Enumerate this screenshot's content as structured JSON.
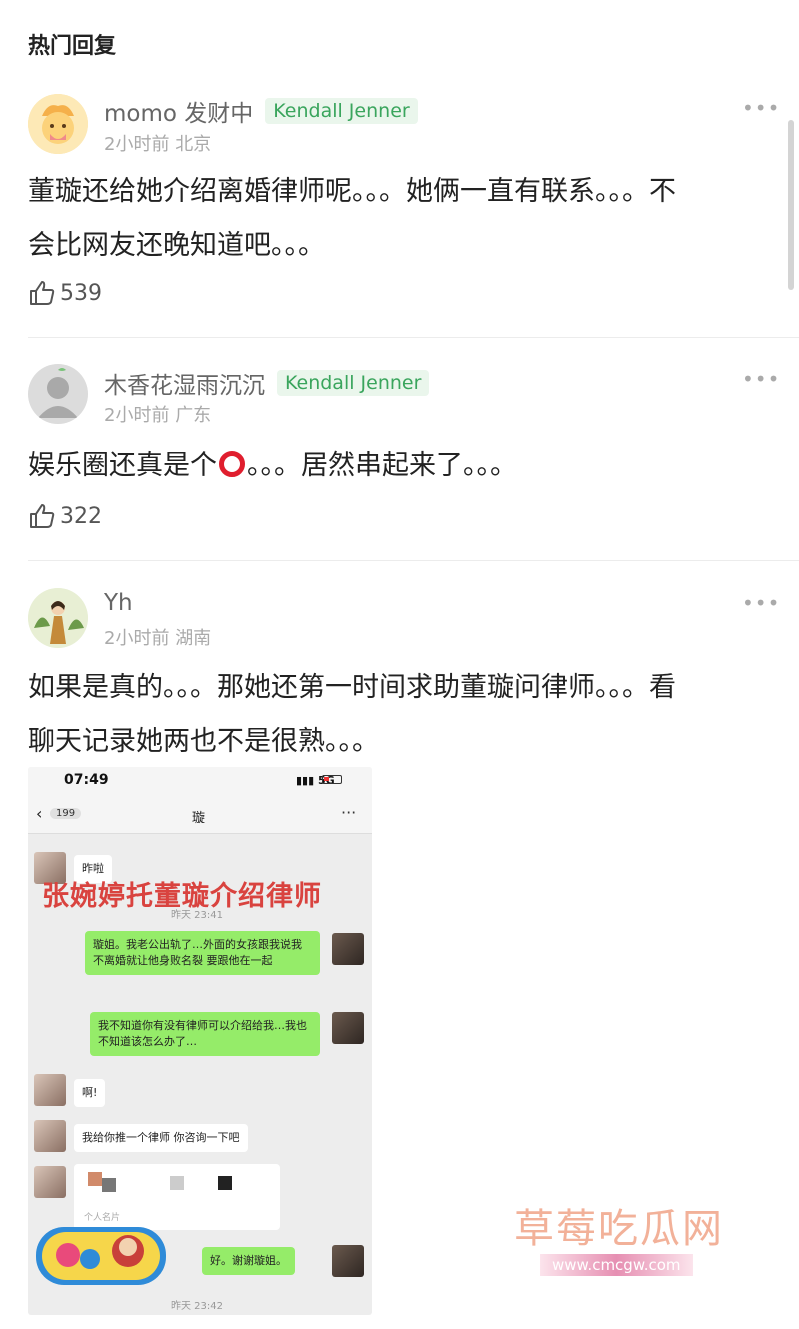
{
  "section_title": "热门回复",
  "comments": [
    {
      "username": "momo 发财中",
      "badge": "Kendall Jenner",
      "time": "2小时前",
      "location": "北京",
      "text_lines": [
        "董璇还给她介绍离婚律师呢。。。她俩一直有联系。。。不",
        "会比网友还晚知道吧。。。"
      ],
      "likes": "539"
    },
    {
      "username": "木香花湿雨沉沉",
      "badge": "Kendall Jenner",
      "time": "2小时前",
      "location": "广东",
      "text_before": "娱乐圈还真是个",
      "text_after": "。。。居然串起来了。。。",
      "likes": "322"
    },
    {
      "username": "Yh",
      "time": "2小时前",
      "location": "湖南",
      "text_lines": [
        "如果是真的。。。那她还第一时间求助董璇问律师。。。看",
        "聊天记录她两也不是很熟。。。"
      ]
    }
  ],
  "chat_screenshot": {
    "time": "07:49",
    "signal": "5G",
    "unread_count": "199",
    "title": "璇",
    "overlay_caption": "张婉婷托董璇介绍律师",
    "messages": [
      {
        "side": "left",
        "text": "昨啦"
      },
      {
        "timestamp": "昨天 23:41"
      },
      {
        "side": "right",
        "text": "璇姐。我老公出轨了…外面的女孩跟我说我不离婚就让他身败名裂 要跟他在一起"
      },
      {
        "side": "right",
        "text": "我不知道你有没有律师可以介绍给我…我也不知道该怎么办了…"
      },
      {
        "side": "left",
        "text": "啊!"
      },
      {
        "side": "left",
        "text": "我给你推一个律师 你咨询一下吧"
      },
      {
        "side": "left",
        "text": "个人名片"
      },
      {
        "side": "right",
        "text": "好。谢谢璇姐。"
      },
      {
        "timestamp": "昨天 23:42"
      }
    ]
  },
  "watermark": {
    "text": "草莓吃瓜网",
    "url": "www.cmcgw.com"
  },
  "colors": {
    "badge_green": "#3aa55d",
    "wechat_green": "#95ec69",
    "overlay_red": "#d9433f"
  }
}
